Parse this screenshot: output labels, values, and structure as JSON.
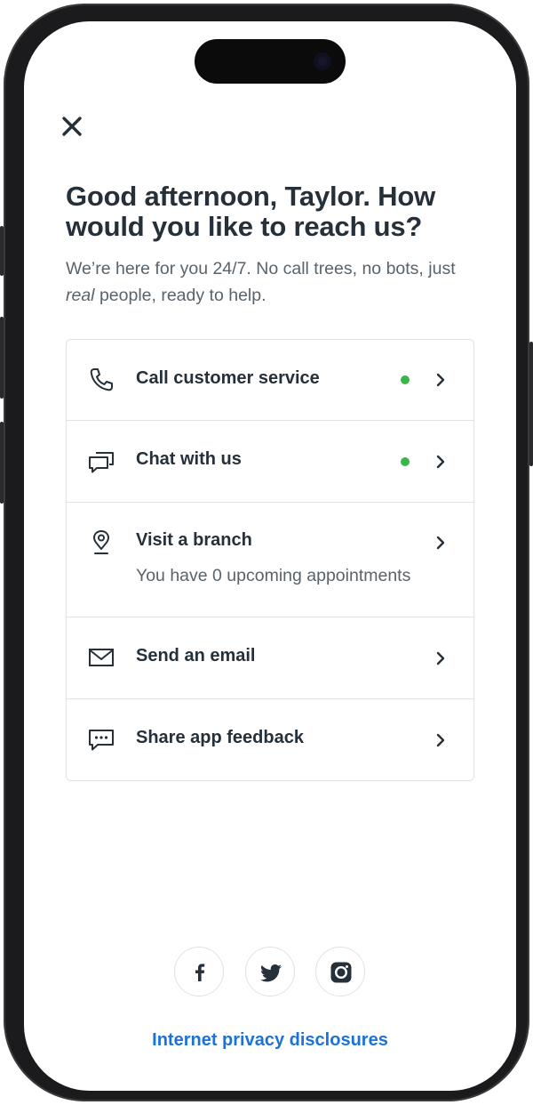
{
  "header": {
    "close_icon": "close-icon",
    "title": "Good afternoon, Taylor. How would you like to reach us?",
    "subtitle_before": "We’re here for you 24/7. No call trees, no bots, just ",
    "subtitle_emphasis": "real",
    "subtitle_after": " people, ready to help."
  },
  "contact_options": [
    {
      "label": "Call customer service",
      "icon": "phone-icon",
      "available": true
    },
    {
      "label": "Chat with us",
      "icon": "chat-icon",
      "available": true
    },
    {
      "label": "Visit a branch",
      "icon": "location-pin-icon",
      "detail": "You have 0 upcoming appointments"
    },
    {
      "label": "Send an email",
      "icon": "envelope-icon"
    },
    {
      "label": "Share app feedback",
      "icon": "feedback-icon"
    }
  ],
  "social": [
    "facebook-icon",
    "twitter-icon",
    "instagram-icon"
  ],
  "footer": {
    "privacy_link": "Internet privacy disclosures"
  },
  "colors": {
    "text": "#25303a",
    "muted": "#59636b",
    "available_dot": "#3bb54a",
    "link": "#1a73d9",
    "border": "#dfe3e6"
  }
}
